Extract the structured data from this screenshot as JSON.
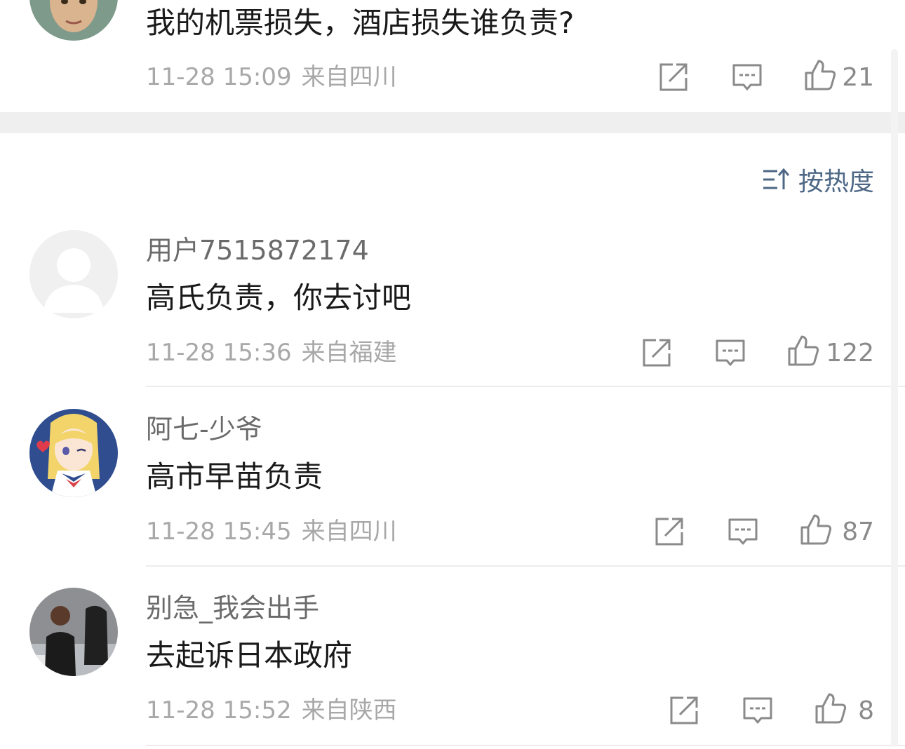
{
  "top_comment": {
    "text": "我的机票损失，酒店损失谁负责?",
    "time": "11-28 15:09",
    "location": "来自四川",
    "likes": "21"
  },
  "sort": {
    "label": "按热度",
    "icon": "sort-icon"
  },
  "comments": [
    {
      "username": "用户7515872174",
      "text": "高氏负责，你去讨吧",
      "time": "11-28 15:36",
      "location": "来自福建",
      "likes": "122"
    },
    {
      "username": "阿七-少爷",
      "text": "高市早苗负责",
      "time": "11-28 15:45",
      "location": "来自四川",
      "likes": "87"
    },
    {
      "username": "别急_我会出手",
      "text": "去起诉日本政府",
      "time": "11-28 15:52",
      "location": "来自陕西",
      "likes": "8"
    }
  ],
  "icons": {
    "share": "share-icon",
    "reply": "comment-icon",
    "like": "thumbs-up-icon"
  },
  "colors": {
    "accent": "#4d6785",
    "meta_text": "#a8a8a8",
    "username": "#6b6b6b",
    "body_text": "#1a1a1a"
  }
}
